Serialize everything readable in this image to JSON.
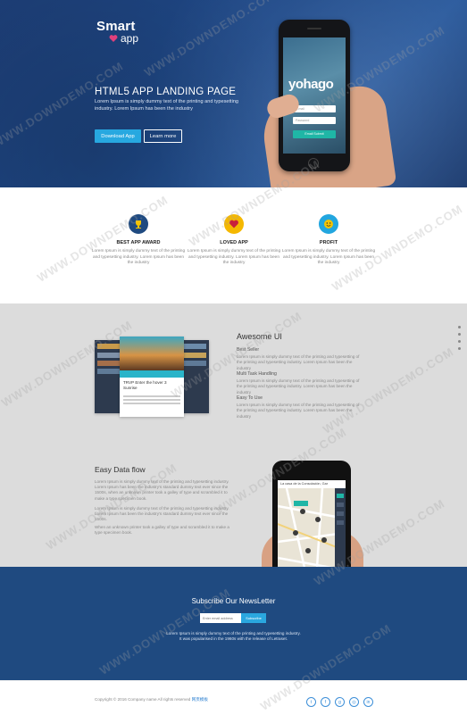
{
  "hero": {
    "logo_line1": "Smart",
    "logo_line2": "app",
    "title": "HTML5 APP LANDING PAGE",
    "text": "Lorem Ipsum is simply dummy text of the printing and typesetting industry. Lorem Ipsum has been the industry",
    "download_label": "Download App",
    "learn_label": "Learn more",
    "phone": {
      "brand": "yohago",
      "email_placeholder": "E-mail",
      "password_placeholder": "Password",
      "submit_label": "Email Submit"
    }
  },
  "features": [
    {
      "title": "BEST APP AWARD",
      "text": "Lorem Ipsum is simply dummy text of the printing and typesetting industry. Lorem Ipsum has been the industry",
      "icon": "trophy-icon",
      "color": "#1f4a80"
    },
    {
      "title": "LOVED APP",
      "text": "Lorem Ipsum is simply dummy text of the printing and typesetting industry. Lorem Ipsum has been the industry",
      "icon": "heart-icon",
      "color": "#f5b800"
    },
    {
      "title": "PROFIT",
      "text": "Lorem Ipsum is simply dummy text of the printing and typesetting industry. Lorem Ipsum has been the industry",
      "icon": "smiley-icon",
      "color": "#22a6df"
    }
  ],
  "awesome": {
    "title": "Awesome UI",
    "items": [
      {
        "heading": "Best Seller",
        "text": "Lorem Ipsum is simply dummy text of the printing and typesetting of the printing and typesetting industry. Lorem Ipsum has been the industry"
      },
      {
        "heading": "Multi Task Handling",
        "text": "Lorem Ipsum is simply dummy text of the printing and typesetting of the printing and typesetting industry. Lorem Ipsum has been the industry"
      },
      {
        "heading": "Easy To Use",
        "text": "Lorem Ipsum is simply dummy text of the printing and typesetting of the printing and typesetting industry. Lorem Ipsum has been the industry"
      }
    ],
    "mock_card_title": "TRVP Enter the hover 3 Sunrise"
  },
  "easy": {
    "title": "Easy Data flow",
    "p1": "Lorem Ipsum is simply dummy text of the printing and typesetting industry. Lorem Ipsum has been the industry's standard dummy text ever since the 1500s, when an unknown printer took a galley of type and scrambled it to make a type specimen book.",
    "p2": "Lorem Ipsum is simply dummy text of the printing and typesetting industry. Lorem Ipsum has been the industry's standard dummy text ever since the 1500s.",
    "p3": "When an unknown printer took a galley of type and scrambled it to make a type specimen book.",
    "map_header": "La casa de la Consolación, Gar"
  },
  "newsletter": {
    "title": "Subscribe Our NewsLetter",
    "placeholder": "Enter email address",
    "button": "Subscribe",
    "text1": "Lorem Ipsum is simply dummy text of the printing and typesetting industry.",
    "text2": "It was popularised in the 1960s with the release of Letraset."
  },
  "footer": {
    "copyright": "Copyright © 2016 Company name All rights reserved ",
    "copyright_link": "网页模板",
    "social": [
      "twitter-icon",
      "facebook-icon",
      "google-plus-icon",
      "dribbble-icon",
      "linkedin-icon"
    ],
    "social_glyphs": [
      "t",
      "f",
      "g",
      "◎",
      "in"
    ]
  },
  "watermark": "WWW.DOWNDEMO.COM"
}
